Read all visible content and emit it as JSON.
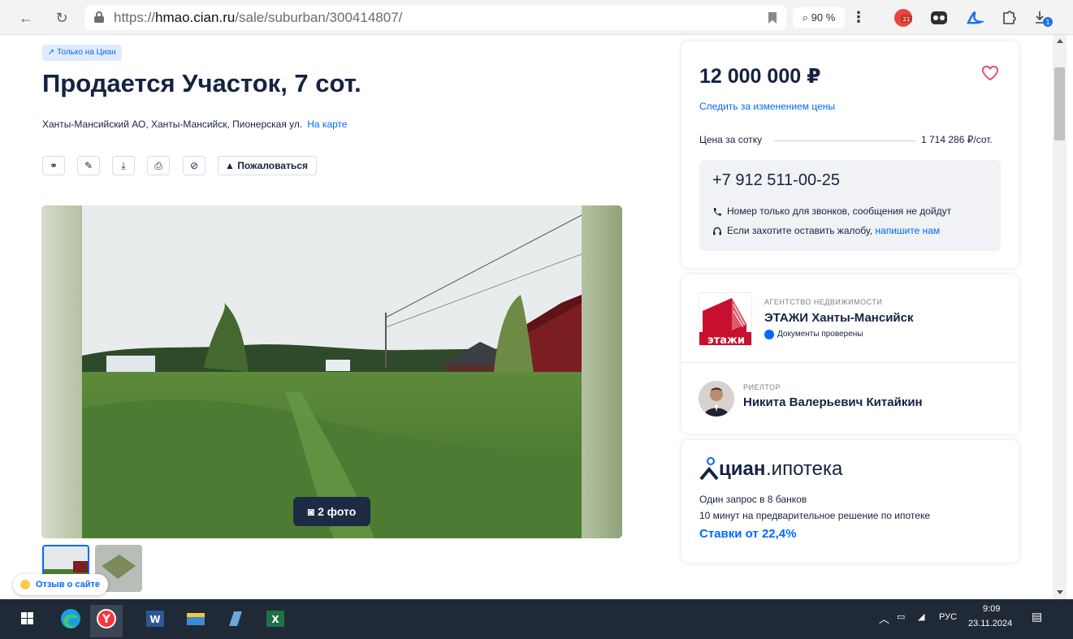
{
  "browser": {
    "url_prefix": "https://",
    "url_host": "hmao.cian.ru",
    "url_path": "/sale/suburban/300414807/",
    "zoom": "90 %",
    "ext_badge_count": "21",
    "download_badge": "1"
  },
  "listing": {
    "badge": "Только на Циан",
    "title": "Продается Участок, 7 сот.",
    "address": "Ханты-Мансийский АО, Ханты-Мансийск, Пионерская ул.",
    "map_link": "На карте",
    "complain_label": "Пожаловаться",
    "photo_counter": "2 фото"
  },
  "feedback": {
    "label": "Отзыв о сайте"
  },
  "price_card": {
    "price": "12 000 000 ₽",
    "track_price": "Следить за изменением цены",
    "per_unit_label": "Цена за сотку",
    "per_unit_value": "1 714 286 ₽/сот.",
    "phone": "+7 912 511-00-25",
    "note_calls": "Номер только для звонков, сообщения не дойдут",
    "note_complaint": "Если захотите оставить жалобу,",
    "note_complaint_link": "напишите нам"
  },
  "agency_card": {
    "logo_text": "этажи",
    "kind": "АГЕНТСТВО НЕДВИЖИМОСТИ",
    "name": "ЭТАЖИ Ханты-Мансийск",
    "verified": "Документы проверены",
    "realtor_kind": "РИЕЛТОР",
    "realtor_name": "Никита Валерьевич Китайкин"
  },
  "mortgage_card": {
    "brand_bold": "циан",
    "brand_light": ".ипотека",
    "line1": "Один запрос в 8 банков",
    "line2": "10 минут на предварительное решение по ипотеке",
    "rate": "Ставки от 22,4%"
  },
  "taskbar": {
    "lang": "РУС",
    "time": "9:09",
    "date": "23.11.2024"
  },
  "colors": {
    "accent": "#0468ff",
    "text": "#152242",
    "heart": "#e84260",
    "agency_red": "#c8102e"
  }
}
